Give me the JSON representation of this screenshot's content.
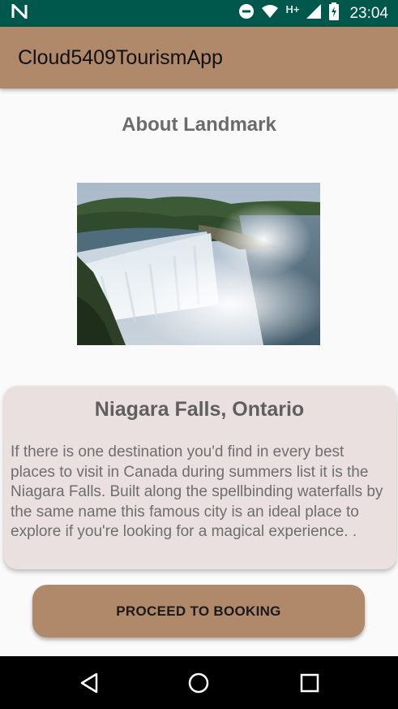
{
  "status_bar": {
    "time": "23:04",
    "network_label": "H+",
    "icons": [
      "notification-n-icon",
      "dnd-icon",
      "wifi-icon",
      "cell-signal-icon",
      "battery-charging-icon"
    ]
  },
  "app_bar": {
    "title": "Cloud5409TourismApp"
  },
  "main": {
    "heading": "About Landmark",
    "card": {
      "title": "Niagara Falls, Ontario",
      "description": "If there is one destination you'd find in every best places to visit in Canada during summers list  it is the Niagara Falls. Built along the spellbinding waterfalls by the same name  this famous city is an ideal place to explore if you're looking for a magical experience.  ."
    },
    "proceed_button_label": "PROCEED TO BOOKING"
  },
  "nav_bar": {
    "icons": [
      "back-icon",
      "home-icon",
      "recents-icon"
    ]
  },
  "colors": {
    "status_bar": "#00574b",
    "app_bar": "#b0886a",
    "card_bg": "#ebe0e0",
    "button": "#b0886a"
  }
}
